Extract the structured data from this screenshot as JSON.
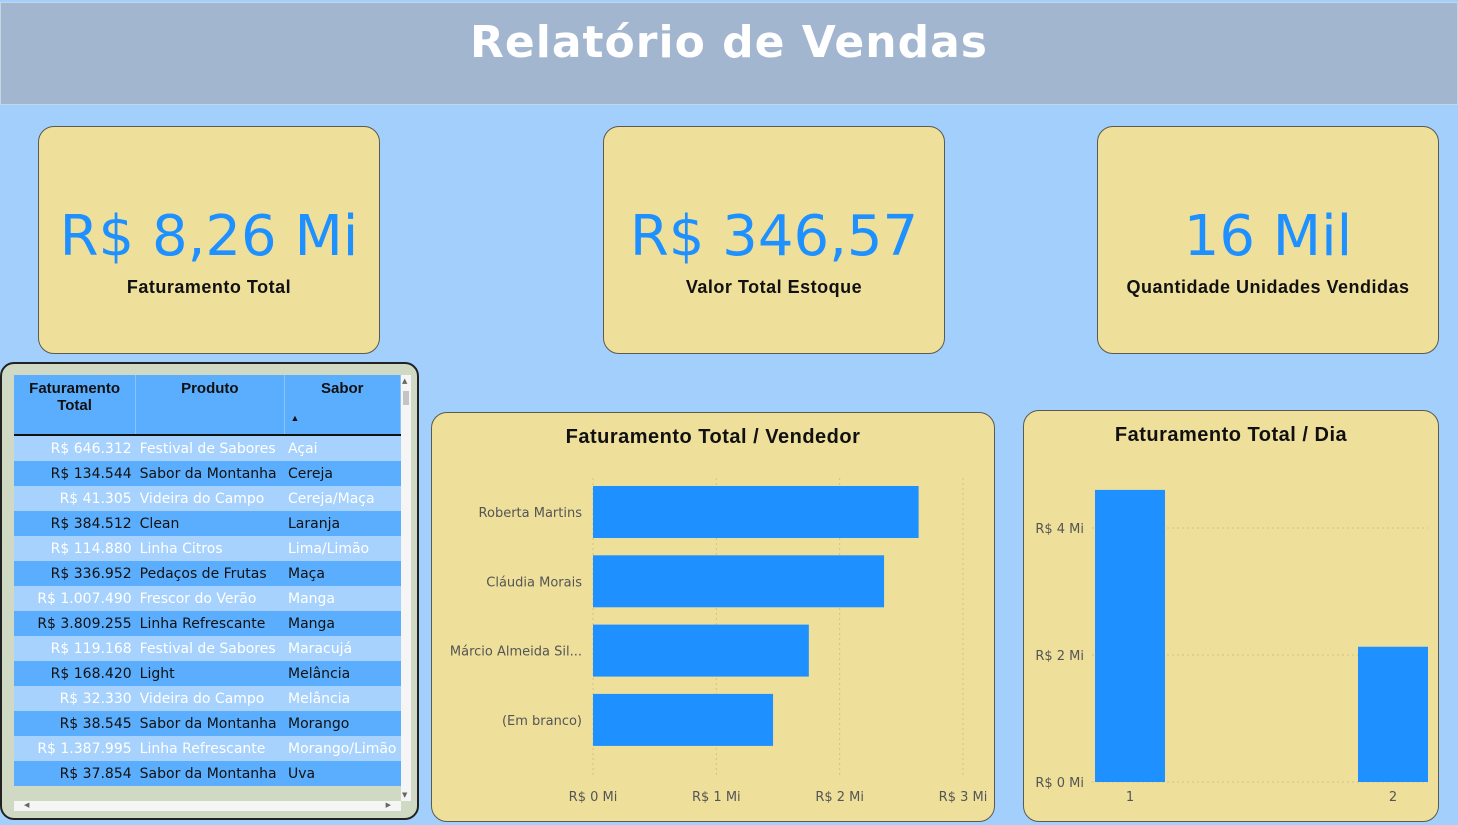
{
  "header": {
    "title": "Relatório de Vendas"
  },
  "kpis": [
    {
      "value": "R$ 8,26 Mi",
      "label": "Faturamento Total"
    },
    {
      "value": "R$ 346,57",
      "label": "Valor Total Estoque"
    },
    {
      "value": "16 Mil",
      "label": "Quantidade Unidades Vendidas"
    }
  ],
  "table": {
    "headers": {
      "faturamento": "Faturamento Total",
      "produto": "Produto",
      "sabor": "Sabor"
    },
    "sort_indicator": "▲",
    "rows": [
      {
        "faturamento": "R$ 646.312",
        "produto": "Festival de Sabores",
        "sabor": "Açai"
      },
      {
        "faturamento": "R$ 134.544",
        "produto": "Sabor da Montanha",
        "sabor": "Cereja"
      },
      {
        "faturamento": "R$ 41.305",
        "produto": "Videira do Campo",
        "sabor": "Cereja/Maça"
      },
      {
        "faturamento": "R$ 384.512",
        "produto": "Clean",
        "sabor": "Laranja"
      },
      {
        "faturamento": "R$ 114.880",
        "produto": "Linha Citros",
        "sabor": "Lima/Limão"
      },
      {
        "faturamento": "R$ 336.952",
        "produto": "Pedaços de Frutas",
        "sabor": "Maça"
      },
      {
        "faturamento": "R$ 1.007.490",
        "produto": "Frescor do Verão",
        "sabor": "Manga"
      },
      {
        "faturamento": "R$ 3.809.255",
        "produto": "Linha Refrescante",
        "sabor": "Manga"
      },
      {
        "faturamento": "R$ 119.168",
        "produto": "Festival de Sabores",
        "sabor": "Maracujá"
      },
      {
        "faturamento": "R$ 168.420",
        "produto": "Light",
        "sabor": "Melância"
      },
      {
        "faturamento": "R$ 32.330",
        "produto": "Videira do Campo",
        "sabor": "Melância"
      },
      {
        "faturamento": "R$ 38.545",
        "produto": "Sabor da Montanha",
        "sabor": "Morango"
      },
      {
        "faturamento": "R$ 1.387.995",
        "produto": "Linha Refrescante",
        "sabor": "Morango/Limão"
      },
      {
        "faturamento": "R$ 37.854",
        "produto": "Sabor da Montanha",
        "sabor": "Uva"
      }
    ]
  },
  "icons": {
    "scroll_up": "▲",
    "scroll_down": "▼",
    "scroll_left": "◀",
    "scroll_right": "▶"
  },
  "colors": {
    "accent": "#1e90ff",
    "card": "#eee09b",
    "background": "#a2cffc",
    "header": "#a2b6d0"
  },
  "chart_data": [
    {
      "type": "bar",
      "orientation": "horizontal",
      "title": "Faturamento Total / Vendedor",
      "categories": [
        "Roberta Martins",
        "Cláudia Morais",
        "Márcio Almeida Sil...",
        "(Em branco)"
      ],
      "values": [
        2.64,
        2.36,
        1.75,
        1.46
      ],
      "xlim": [
        0,
        3
      ],
      "ticks": [
        "R$ 0 Mi",
        "R$ 1 Mi",
        "R$ 2 Mi",
        "R$ 3 Mi"
      ],
      "grid": true
    },
    {
      "type": "bar",
      "orientation": "vertical",
      "title": "Faturamento Total / Dia",
      "categories": [
        "1",
        "2"
      ],
      "values": [
        4.6,
        2.13
      ],
      "ylim": [
        0,
        4
      ],
      "ticks": [
        "R$ 0 Mi",
        "R$ 2 Mi",
        "R$ 4 Mi"
      ],
      "grid": true
    }
  ]
}
